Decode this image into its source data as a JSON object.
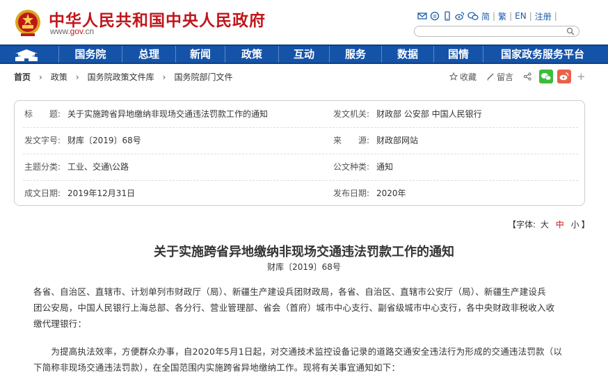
{
  "header": {
    "site_title": "中华人民共和国中央人民政府",
    "site_url_prefix": "www.",
    "site_url_red": "gov",
    "site_url_suffix": ".cn",
    "tools": [
      "简",
      "繁",
      "EN",
      "注册"
    ],
    "icons": [
      "mail-icon",
      "comment-icon",
      "mobile-icon",
      "weibo-icon",
      "wechat-icon"
    ]
  },
  "nav": {
    "items": [
      "国务院",
      "总理",
      "新闻",
      "政策",
      "互动",
      "服务",
      "数据",
      "国情",
      "国家政务服务平台"
    ]
  },
  "breadcrumb": [
    "首页",
    "政策",
    "国务院政策文件库",
    "国务院部门文件"
  ],
  "actions": {
    "favorite": "收藏",
    "comment": "留言"
  },
  "meta": {
    "title_label": "标　　题:",
    "title_value": "关于实施跨省异地缴纳非现场交通违法罚款工作的通知",
    "issuer_label": "发文机关:",
    "issuer_value": "财政部 公安部 中国人民银行",
    "docno_label": "发文字号:",
    "docno_value": "财库〔2019〕68号",
    "source_label": "来　　源:",
    "source_value": "财政部网站",
    "category_label": "主题分类:",
    "category_value": "工业、交通\\公路",
    "type_label": "公文种类:",
    "type_value": "通知",
    "created_label": "成文日期:",
    "created_value": "2019年12月31日",
    "published_label": "发布日期:",
    "published_value": "2020年"
  },
  "fontsize": {
    "prefix": "【字体:",
    "large": "大",
    "medium": "中",
    "small": "小",
    "suffix": "】"
  },
  "document": {
    "title": "关于实施跨省异地缴纳非现场交通违法罚款工作的通知",
    "number": "财库〔2019〕68号",
    "para1_line1": "各省、自治区、直辖市、计划单列市财政厅（局）、新疆生产建设兵团财政局，各省、自治区、直辖市公安厅（局）、新疆生产建设兵",
    "para1_line2": "团公安局，中国人民银行上海总部、各分行、营业管理部、省会（首府）城市中心支行、副省级城市中心支行，各中央财政非税收入收",
    "para1_line3": "缴代理银行：",
    "para2_line1": "　　为提高执法效率，方便群众办事，自2020年5月1日起，对交通技术监控设备记录的道路交通安全违法行为形成的交通违法罚款（以",
    "para2_line2": "下简称非现场交通违法罚款），在全国范围内实施跨省异地缴纳工作。现将有关事宜通知如下："
  },
  "colors": {
    "brand_red": "#c0161b",
    "nav_blue": "#1553a8",
    "wechat_green": "#3dbb3b",
    "weibo_orange": "#e9614c"
  }
}
